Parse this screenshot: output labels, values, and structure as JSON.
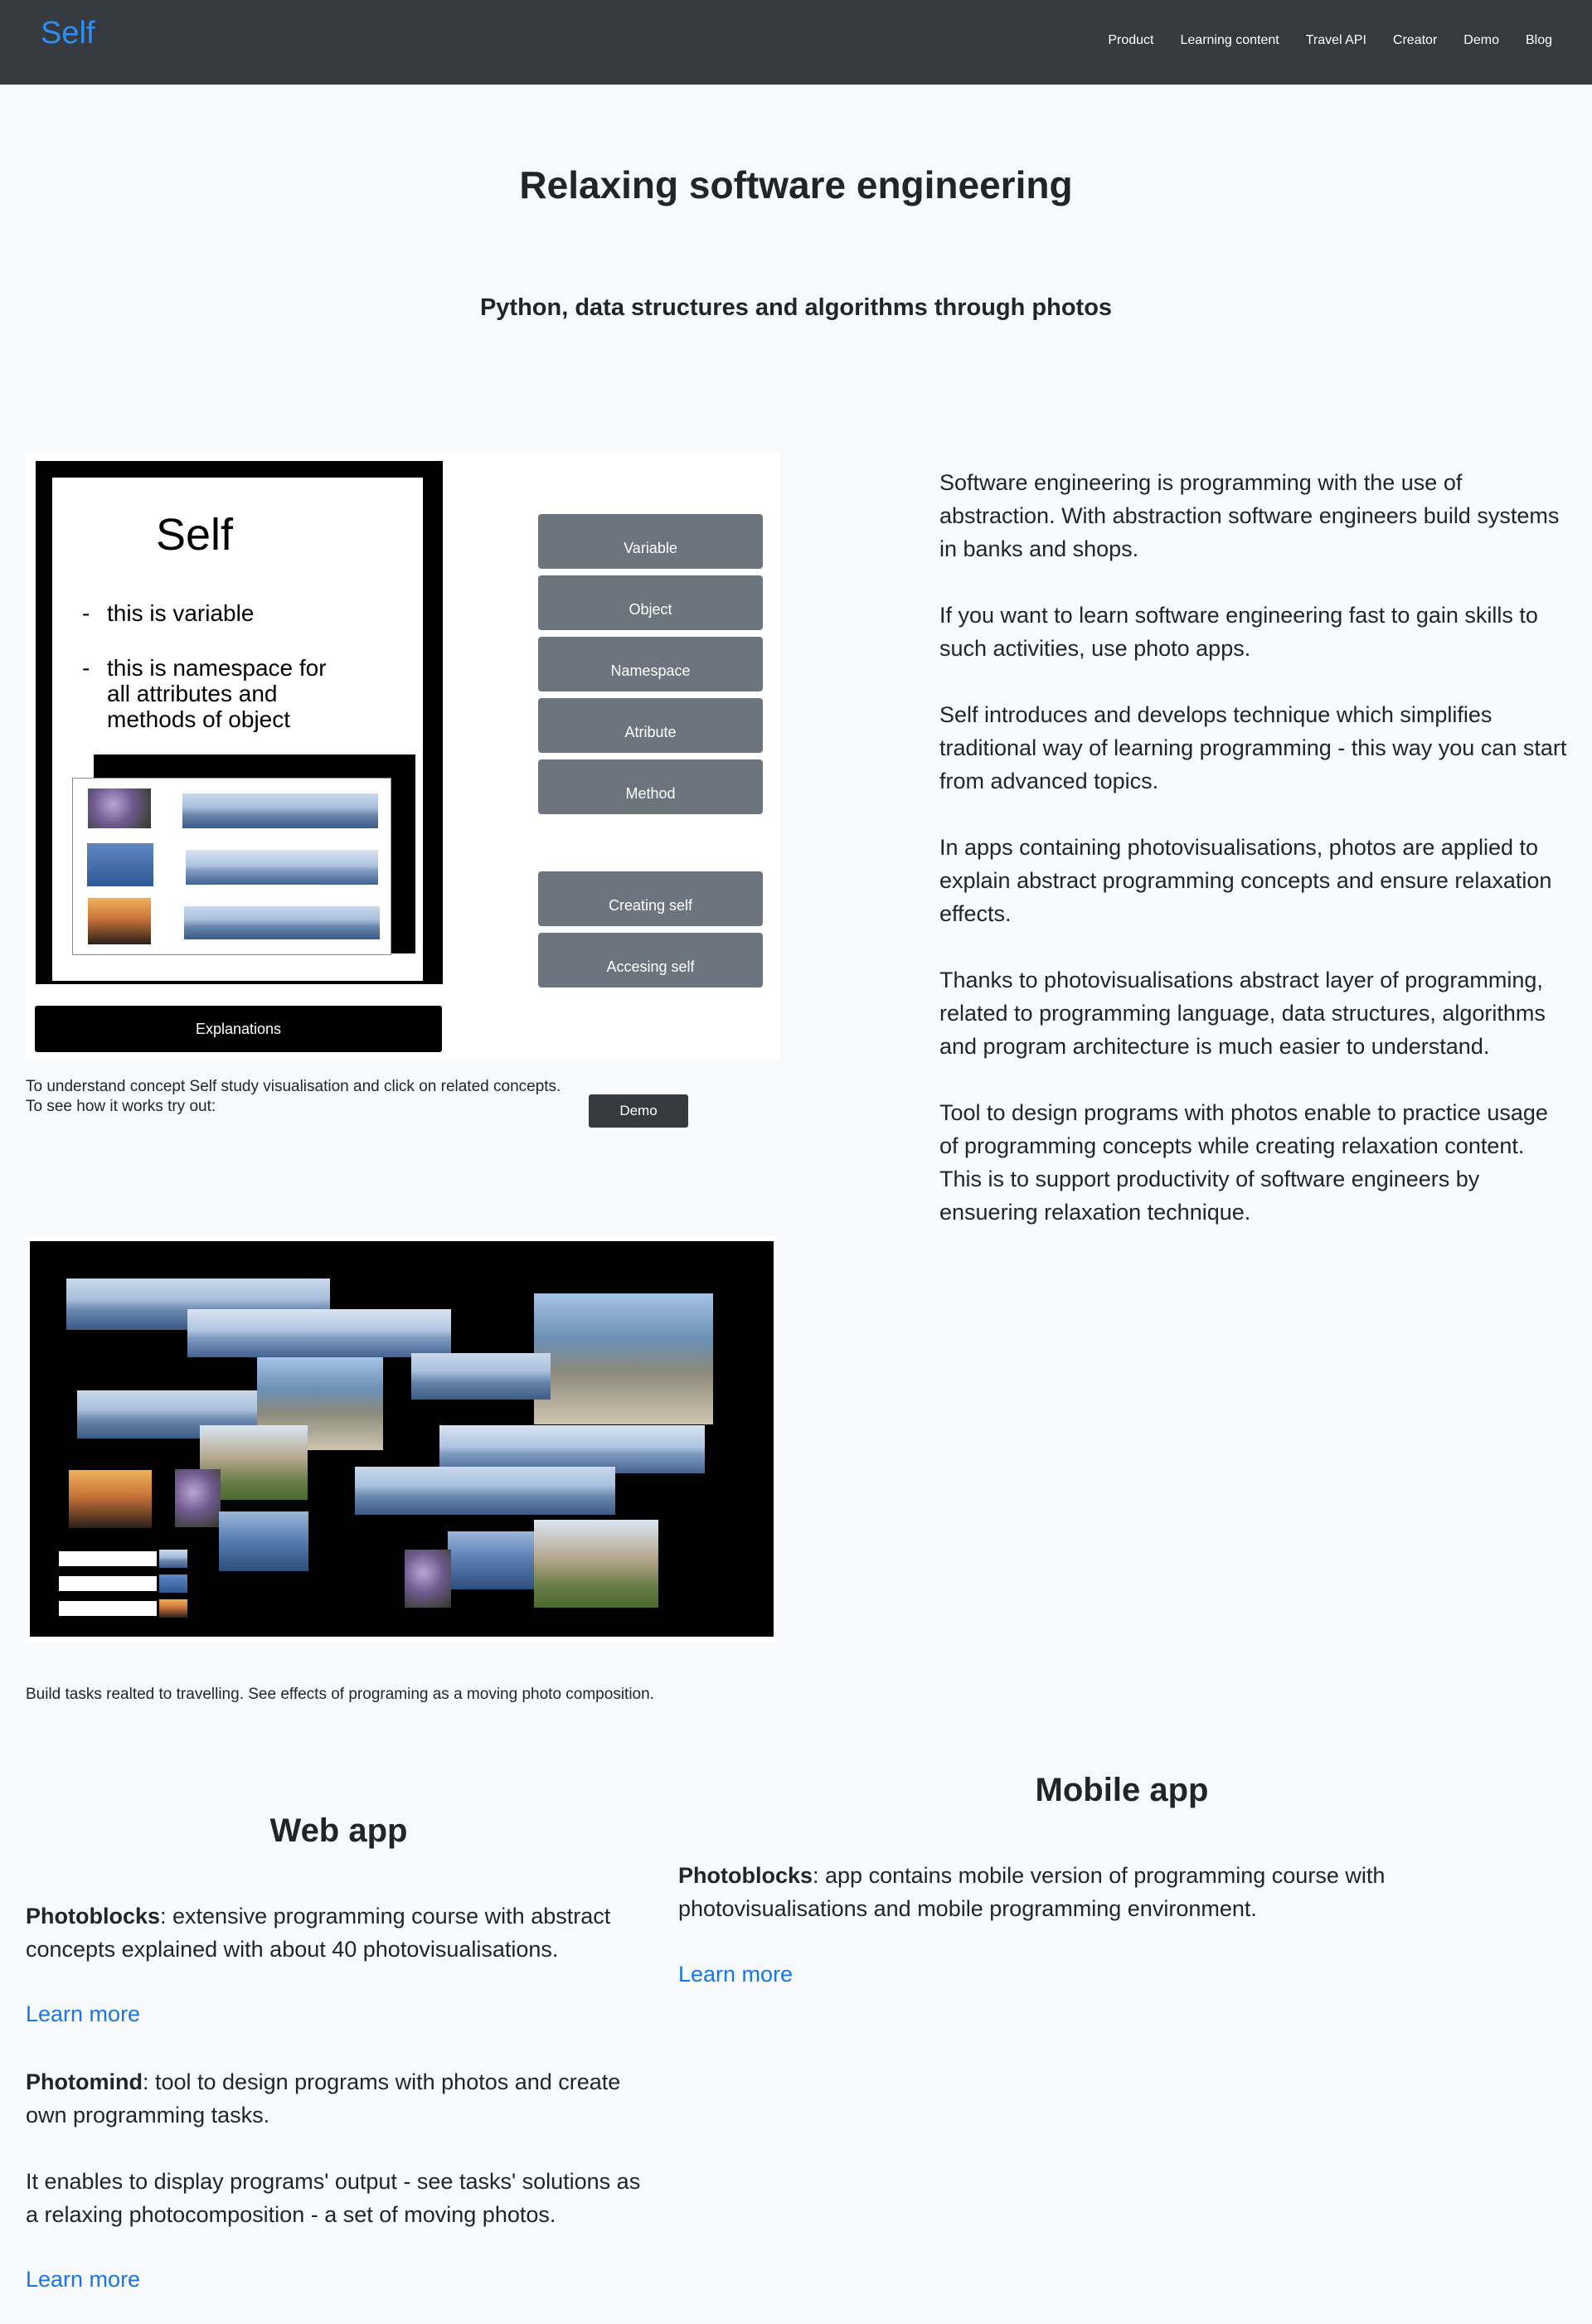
{
  "nav": {
    "brand": "Self",
    "links": [
      "Product",
      "Learning content",
      "Travel API",
      "Creator",
      "Demo",
      "Blog"
    ]
  },
  "hero": {
    "title": "Relaxing software engineering",
    "subtitle": "Python, data structures and algorithms through photos"
  },
  "viz_self": {
    "slide_title": "Self",
    "bullets": [
      "this is variable",
      "this is namespace for all attributes and methods of object"
    ],
    "concept_buttons": [
      "Variable",
      "Object",
      "Namespace",
      "Atribute",
      "Method",
      "Creating self",
      "Accesing self"
    ],
    "explanations_label": "Explanations",
    "caption_line1": "To understand concept Self study visualisation and click on related concepts.",
    "caption_line2": "To see how it works try out:",
    "demo_label": "Demo"
  },
  "about": {
    "paragraphs": [
      "Software engineering is programming with the use of abstraction. With abstraction software engineers build systems in banks and shops.",
      "If you want to learn software engineering fast to gain skills to such activities, use photo apps.",
      "Self introduces and develops technique which simplifies traditional way of learning programming - this way you can start from advanced topics.",
      "In apps containing photovisualisations, photos are applied to explain abstract programming concepts and ensure relaxation effects.",
      "Thanks to photovisualisations abstract layer of programming, related to programming language, data structures, algorithms and program architecture is much easier to understand.",
      "Tool to design programs with photos enable to practice usage of programming concepts while creating relaxation content. This is to support productivity of software engineers by ensuering relaxation technique."
    ]
  },
  "viz_travel": {
    "caption": "Build tasks realted to travelling. See effects of programing as a moving photo composition."
  },
  "web_app": {
    "title": "Web app",
    "photoblocks_name": "Photoblocks",
    "photoblocks_desc": ": extensive programming course with abstract concepts explained with about 40 photovisualisations.",
    "learn_more_1": "Learn more",
    "photomind_name": "Photomind",
    "photomind_desc": ": tool to design programs with photos and create own programming tasks.",
    "photomind_extra": "It enables to display programs' output - see tasks' solutions as a relaxing photocomposition - a set of moving photos.",
    "learn_more_2": "Learn more"
  },
  "mobile_app": {
    "title": "Mobile app",
    "photoblocks_name": "Photoblocks",
    "photoblocks_desc": ": app contains mobile version of programming course with photovisualisations and mobile programming environment.",
    "learn_more": "Learn more"
  },
  "colors": {
    "navbar": "#343a40",
    "brand": "#2f8ff0",
    "link": "#1877e0",
    "concept_button": "#6c757d",
    "page_bg": "#f8f9fd"
  }
}
